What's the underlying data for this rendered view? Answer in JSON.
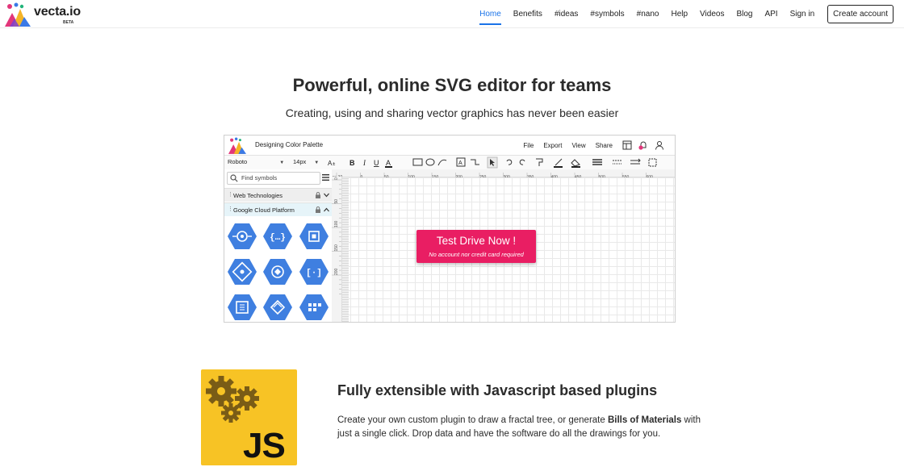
{
  "brand": {
    "name": "vecta.io",
    "badge": "BETA"
  },
  "nav": {
    "links": [
      "Home",
      "Benefits",
      "#ideas",
      "#symbols",
      "#nano",
      "Help",
      "Videos",
      "Blog",
      "API",
      "Sign in"
    ],
    "active": "Home",
    "cta": "Create account"
  },
  "hero": {
    "title": "Powerful, online SVG editor for teams",
    "subtitle": "Creating, using and sharing vector graphics has never been easier"
  },
  "editor": {
    "doc_title": "Designing Color Palette",
    "menu": [
      "File",
      "Export",
      "View",
      "Share"
    ],
    "font": "Roboto",
    "font_size": "14px",
    "search_placeholder": "Find symbols",
    "sections": [
      "Web Technologies",
      "Google Cloud Platform"
    ],
    "ruler_unit": "px",
    "ruler_top": [
      "-30",
      "0",
      "50",
      "100",
      "150",
      "200",
      "250",
      "300",
      "350",
      "400",
      "450",
      "500",
      "550",
      "600"
    ],
    "ruler_left": [
      "0",
      "50",
      "100",
      "150",
      "200"
    ]
  },
  "cta": {
    "main": "Test Drive Now !",
    "sub": "No account nor credit card required"
  },
  "feature": {
    "tile_label": "JS",
    "title": "Fully extensible with Javascript based plugins",
    "body_before": "Create your own custom plugin to draw a fractal tree, or generate ",
    "body_bold": "Bills of Materials",
    "body_after": " with just a single click. Drop data and have the software do all the drawings for you."
  },
  "colors": {
    "accent": "#1a73e8",
    "cta": "#e91e63",
    "tile": "#f7c325",
    "hex_icon": "#3f7fe0"
  }
}
